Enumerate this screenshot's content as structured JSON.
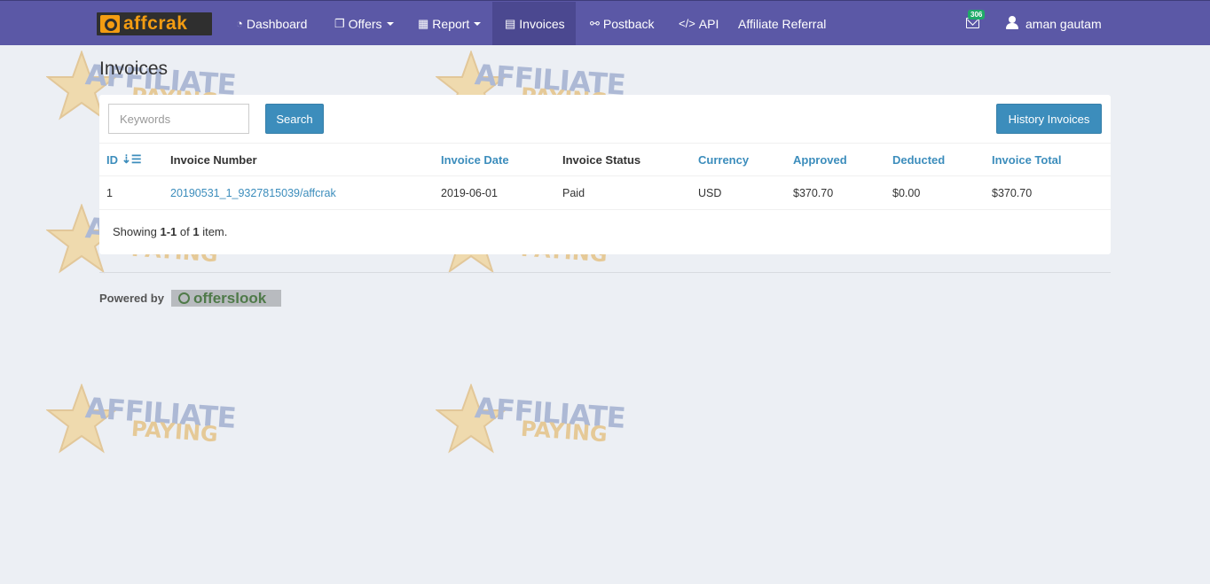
{
  "brand": {
    "name": "affcrak"
  },
  "nav": {
    "items": [
      {
        "label": "Dashboard",
        "icon": "dashboard-icon"
      },
      {
        "label": "Offers",
        "icon": "offers-icon"
      },
      {
        "label": "Report",
        "icon": "report-icon"
      },
      {
        "label": "Invoices",
        "icon": "invoices-icon"
      },
      {
        "label": "Postback",
        "icon": "link-icon"
      },
      {
        "label": "API",
        "icon": "code-icon"
      },
      {
        "label": "Affiliate Referral"
      }
    ],
    "active": "Invoices",
    "mail_count": "306",
    "user_name": "aman gautam"
  },
  "watermark": {
    "line1": "AFFILIATE",
    "line2": "PAYING"
  },
  "page": {
    "title": "Invoices"
  },
  "search": {
    "placeholder": "Keywords",
    "button": "Search"
  },
  "history_button": "History Invoices",
  "table": {
    "columns": [
      "ID",
      "Invoice Number",
      "Invoice Date",
      "Invoice Status",
      "Currency",
      "Approved",
      "Deducted",
      "Invoice Total"
    ],
    "rows": [
      {
        "id": "1",
        "invoice_number": "20190531_1_9327815039/affcrak",
        "invoice_date": "2019-06-01",
        "status": "Paid",
        "currency": "USD",
        "approved": "$370.70",
        "deducted": "$0.00",
        "total": "$370.70"
      }
    ]
  },
  "summary": {
    "prefix": "Showing ",
    "range": "1-1",
    "of": " of ",
    "count": "1",
    "suffix": " item."
  },
  "footer": {
    "powered_by": "Powered by",
    "vendor": "offerslook"
  },
  "colors": {
    "navbar": "#5b58a6",
    "accent": "#3c8dbc",
    "background": "#eceff4"
  }
}
